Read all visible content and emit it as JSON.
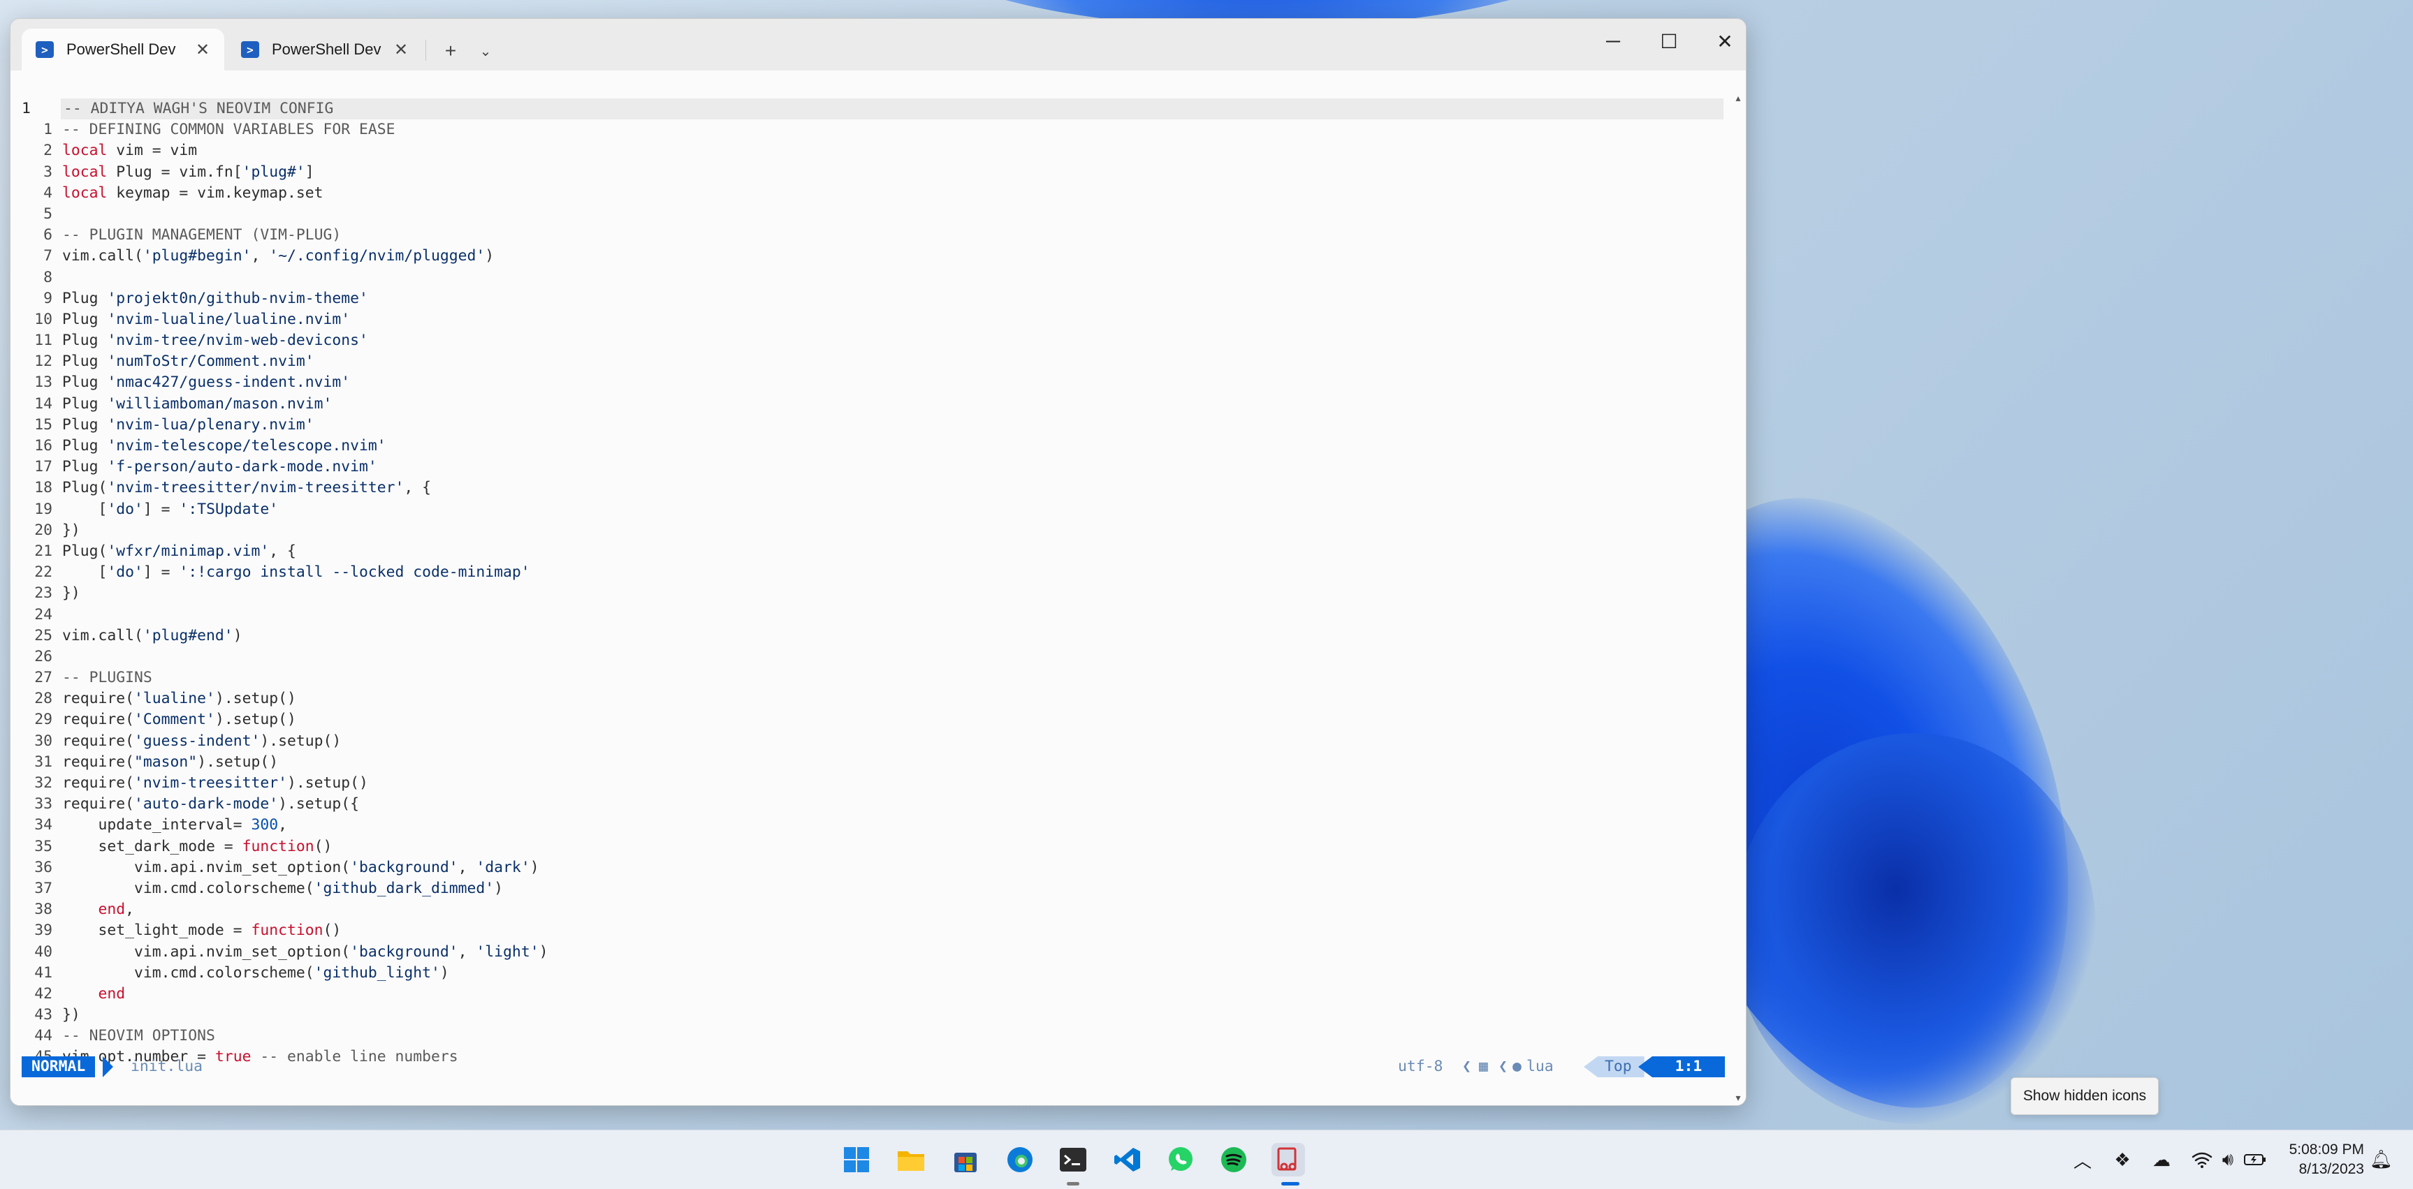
{
  "window": {
    "tabs": [
      {
        "label": "PowerShell Dev",
        "active": true
      },
      {
        "label": "PowerShell Dev",
        "active": false
      }
    ],
    "new_tab_icon": "plus-icon",
    "dropdown_icon": "chevron-down-icon",
    "controls": [
      "minimize-icon",
      "maximize-icon",
      "close-icon"
    ]
  },
  "editor": {
    "current_line_number": "1",
    "lines": [
      {
        "n": "",
        "parts": [
          {
            "t": "-- ADITYA WAGH'S NEOVIM CONFIG",
            "c": "cmt"
          }
        ]
      },
      {
        "n": "1",
        "parts": [
          {
            "t": "-- DEFINING COMMON VARIABLES FOR EASE",
            "c": "cmt"
          }
        ]
      },
      {
        "n": "2",
        "parts": [
          {
            "t": "local",
            "c": "kw"
          },
          {
            "t": " vim = vim",
            "c": "code"
          }
        ]
      },
      {
        "n": "3",
        "parts": [
          {
            "t": "local",
            "c": "kw"
          },
          {
            "t": " Plug = vim.fn[",
            "c": "code"
          },
          {
            "t": "'plug#'",
            "c": "str"
          },
          {
            "t": "]",
            "c": "code"
          }
        ]
      },
      {
        "n": "4",
        "parts": [
          {
            "t": "local",
            "c": "kw"
          },
          {
            "t": " keymap = vim.keymap.set",
            "c": "code"
          }
        ]
      },
      {
        "n": "5",
        "parts": []
      },
      {
        "n": "6",
        "parts": [
          {
            "t": "-- PLUGIN MANAGEMENT (VIM-PLUG)",
            "c": "cmt"
          }
        ]
      },
      {
        "n": "7",
        "parts": [
          {
            "t": "vim.call(",
            "c": "code"
          },
          {
            "t": "'plug#begin'",
            "c": "str"
          },
          {
            "t": ", ",
            "c": "code"
          },
          {
            "t": "'~/.config/nvim/plugged'",
            "c": "str"
          },
          {
            "t": ")",
            "c": "code"
          }
        ]
      },
      {
        "n": "8",
        "parts": []
      },
      {
        "n": "9",
        "parts": [
          {
            "t": "Plug ",
            "c": "code"
          },
          {
            "t": "'projekt0n/github-nvim-theme'",
            "c": "str"
          }
        ]
      },
      {
        "n": "10",
        "parts": [
          {
            "t": "Plug ",
            "c": "code"
          },
          {
            "t": "'nvim-lualine/lualine.nvim'",
            "c": "str"
          }
        ]
      },
      {
        "n": "11",
        "parts": [
          {
            "t": "Plug ",
            "c": "code"
          },
          {
            "t": "'nvim-tree/nvim-web-devicons'",
            "c": "str"
          }
        ]
      },
      {
        "n": "12",
        "parts": [
          {
            "t": "Plug ",
            "c": "code"
          },
          {
            "t": "'numToStr/Comment.nvim'",
            "c": "str"
          }
        ]
      },
      {
        "n": "13",
        "parts": [
          {
            "t": "Plug ",
            "c": "code"
          },
          {
            "t": "'nmac427/guess-indent.nvim'",
            "c": "str"
          }
        ]
      },
      {
        "n": "14",
        "parts": [
          {
            "t": "Plug ",
            "c": "code"
          },
          {
            "t": "'williamboman/mason.nvim'",
            "c": "str"
          }
        ]
      },
      {
        "n": "15",
        "parts": [
          {
            "t": "Plug ",
            "c": "code"
          },
          {
            "t": "'nvim-lua/plenary.nvim'",
            "c": "str"
          }
        ]
      },
      {
        "n": "16",
        "parts": [
          {
            "t": "Plug ",
            "c": "code"
          },
          {
            "t": "'nvim-telescope/telescope.nvim'",
            "c": "str"
          }
        ]
      },
      {
        "n": "17",
        "parts": [
          {
            "t": "Plug ",
            "c": "code"
          },
          {
            "t": "'f-person/auto-dark-mode.nvim'",
            "c": "str"
          }
        ]
      },
      {
        "n": "18",
        "parts": [
          {
            "t": "Plug(",
            "c": "code"
          },
          {
            "t": "'nvim-treesitter/nvim-treesitter'",
            "c": "str"
          },
          {
            "t": ", {",
            "c": "code"
          }
        ]
      },
      {
        "n": "19",
        "parts": [
          {
            "t": "    [",
            "c": "code"
          },
          {
            "t": "'do'",
            "c": "str"
          },
          {
            "t": "] = ",
            "c": "code"
          },
          {
            "t": "':TSUpdate'",
            "c": "str"
          }
        ]
      },
      {
        "n": "20",
        "parts": [
          {
            "t": "})",
            "c": "code"
          }
        ]
      },
      {
        "n": "21",
        "parts": [
          {
            "t": "Plug(",
            "c": "code"
          },
          {
            "t": "'wfxr/minimap.vim'",
            "c": "str"
          },
          {
            "t": ", {",
            "c": "code"
          }
        ]
      },
      {
        "n": "22",
        "parts": [
          {
            "t": "    [",
            "c": "code"
          },
          {
            "t": "'do'",
            "c": "str"
          },
          {
            "t": "] = ",
            "c": "code"
          },
          {
            "t": "':!cargo install --locked code-minimap'",
            "c": "str"
          }
        ]
      },
      {
        "n": "23",
        "parts": [
          {
            "t": "})",
            "c": "code"
          }
        ]
      },
      {
        "n": "24",
        "parts": []
      },
      {
        "n": "25",
        "parts": [
          {
            "t": "vim.call(",
            "c": "code"
          },
          {
            "t": "'plug#end'",
            "c": "str"
          },
          {
            "t": ")",
            "c": "code"
          }
        ]
      },
      {
        "n": "26",
        "parts": []
      },
      {
        "n": "27",
        "parts": [
          {
            "t": "-- PLUGINS",
            "c": "cmt"
          }
        ]
      },
      {
        "n": "28",
        "parts": [
          {
            "t": "require(",
            "c": "code"
          },
          {
            "t": "'lualine'",
            "c": "str"
          },
          {
            "t": ").setup()",
            "c": "code"
          }
        ]
      },
      {
        "n": "29",
        "parts": [
          {
            "t": "require(",
            "c": "code"
          },
          {
            "t": "'Comment'",
            "c": "str"
          },
          {
            "t": ").setup()",
            "c": "code"
          }
        ]
      },
      {
        "n": "30",
        "parts": [
          {
            "t": "require(",
            "c": "code"
          },
          {
            "t": "'guess-indent'",
            "c": "str"
          },
          {
            "t": ").setup()",
            "c": "code"
          }
        ]
      },
      {
        "n": "31",
        "parts": [
          {
            "t": "require(",
            "c": "code"
          },
          {
            "t": "\"mason\"",
            "c": "str"
          },
          {
            "t": ").setup()",
            "c": "code"
          }
        ]
      },
      {
        "n": "32",
        "parts": [
          {
            "t": "require(",
            "c": "code"
          },
          {
            "t": "'nvim-treesitter'",
            "c": "str"
          },
          {
            "t": ").setup()",
            "c": "code"
          }
        ]
      },
      {
        "n": "33",
        "parts": [
          {
            "t": "require(",
            "c": "code"
          },
          {
            "t": "'auto-dark-mode'",
            "c": "str"
          },
          {
            "t": ").setup({",
            "c": "code"
          }
        ]
      },
      {
        "n": "34",
        "parts": [
          {
            "t": "    update_interval= ",
            "c": "code"
          },
          {
            "t": "300",
            "c": "num"
          },
          {
            "t": ",",
            "c": "code"
          }
        ]
      },
      {
        "n": "35",
        "parts": [
          {
            "t": "    set_dark_mode = ",
            "c": "code"
          },
          {
            "t": "function",
            "c": "kw"
          },
          {
            "t": "()",
            "c": "code"
          }
        ]
      },
      {
        "n": "36",
        "parts": [
          {
            "t": "        vim.api.nvim_set_option(",
            "c": "code"
          },
          {
            "t": "'background'",
            "c": "str"
          },
          {
            "t": ", ",
            "c": "code"
          },
          {
            "t": "'dark'",
            "c": "str"
          },
          {
            "t": ")",
            "c": "code"
          }
        ]
      },
      {
        "n": "37",
        "parts": [
          {
            "t": "        vim.cmd.colorscheme(",
            "c": "code"
          },
          {
            "t": "'github_dark_dimmed'",
            "c": "str"
          },
          {
            "t": ")",
            "c": "code"
          }
        ]
      },
      {
        "n": "38",
        "parts": [
          {
            "t": "    ",
            "c": "code"
          },
          {
            "t": "end",
            "c": "kw"
          },
          {
            "t": ",",
            "c": "code"
          }
        ]
      },
      {
        "n": "39",
        "parts": [
          {
            "t": "    set_light_mode = ",
            "c": "code"
          },
          {
            "t": "function",
            "c": "kw"
          },
          {
            "t": "()",
            "c": "code"
          }
        ]
      },
      {
        "n": "40",
        "parts": [
          {
            "t": "        vim.api.nvim_set_option(",
            "c": "code"
          },
          {
            "t": "'background'",
            "c": "str"
          },
          {
            "t": ", ",
            "c": "code"
          },
          {
            "t": "'light'",
            "c": "str"
          },
          {
            "t": ")",
            "c": "code"
          }
        ]
      },
      {
        "n": "41",
        "parts": [
          {
            "t": "        vim.cmd.colorscheme(",
            "c": "code"
          },
          {
            "t": "'github_light'",
            "c": "str"
          },
          {
            "t": ")",
            "c": "code"
          }
        ]
      },
      {
        "n": "42",
        "parts": [
          {
            "t": "    ",
            "c": "code"
          },
          {
            "t": "end",
            "c": "kw"
          }
        ]
      },
      {
        "n": "43",
        "parts": [
          {
            "t": "})",
            "c": "code"
          }
        ]
      },
      {
        "n": "44",
        "parts": [
          {
            "t": "-- NEOVIM OPTIONS",
            "c": "cmt"
          }
        ]
      },
      {
        "n": "45",
        "parts": [
          {
            "t": "vim.opt.number = ",
            "c": "code"
          },
          {
            "t": "true",
            "c": "kw"
          },
          {
            "t": " -- enable line numbers",
            "c": "cmt"
          }
        ]
      }
    ]
  },
  "statusline": {
    "mode": "NORMAL",
    "filename": "init.lua",
    "encoding": "utf-8",
    "os_icon": "windows-icon",
    "filetype": "lua",
    "position": "Top",
    "cursor": "1:1"
  },
  "tooltip": "Show hidden icons",
  "taskbar": {
    "apps": [
      "start-icon",
      "file-explorer-icon",
      "microsoft-store-icon",
      "edge-icon",
      "terminal-icon",
      "vscode-icon",
      "whatsapp-icon",
      "spotify-icon",
      "snipping-tool-icon"
    ],
    "tray": [
      "chevron-up-icon",
      "dropbox-icon",
      "onedrive-icon",
      "wifi-icon",
      "volume-icon",
      "battery-icon"
    ],
    "time": "5:08:09 PM",
    "date": "8/13/2023"
  },
  "colors": {
    "accent": "#0969da",
    "keyword": "#c8102e",
    "string": "#0a3069",
    "comment": "#5a5a5a"
  }
}
